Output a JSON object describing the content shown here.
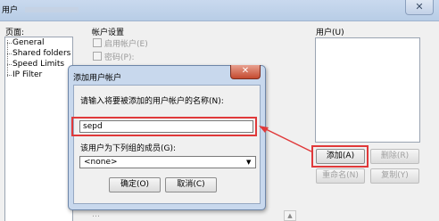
{
  "window": {
    "title": "用户",
    "close_glyph": "✕"
  },
  "pages": {
    "label": "页面:",
    "items": [
      "General",
      "Shared folders",
      "Speed Limits",
      "IP Filter"
    ]
  },
  "account": {
    "label": "帐户设置",
    "enable_label": "启用帐户(E)",
    "password_label": "密码(P):"
  },
  "users": {
    "label": "用户(U)",
    "buttons": {
      "add": "添加(A)",
      "delete": "删除(R)",
      "rename": "重命名(N)",
      "copy": "复制(Y)"
    }
  },
  "bottom": {
    "text": "…",
    "scroll_glyph": "▲"
  },
  "dialog": {
    "title": "添加用户帐户",
    "close_glyph": "✕",
    "prompt": "请输入将要被添加的用户帐户的名称(N):",
    "name_value": "sepd",
    "group_label": "该用户为下列组的成员(G):",
    "group_value": "<none>",
    "dropdown_glyph": "▼",
    "ok": "确定(O)",
    "cancel": "取消(C)"
  },
  "colors": {
    "highlight": "#e0393a",
    "titlebar": "#c2d4eb"
  }
}
